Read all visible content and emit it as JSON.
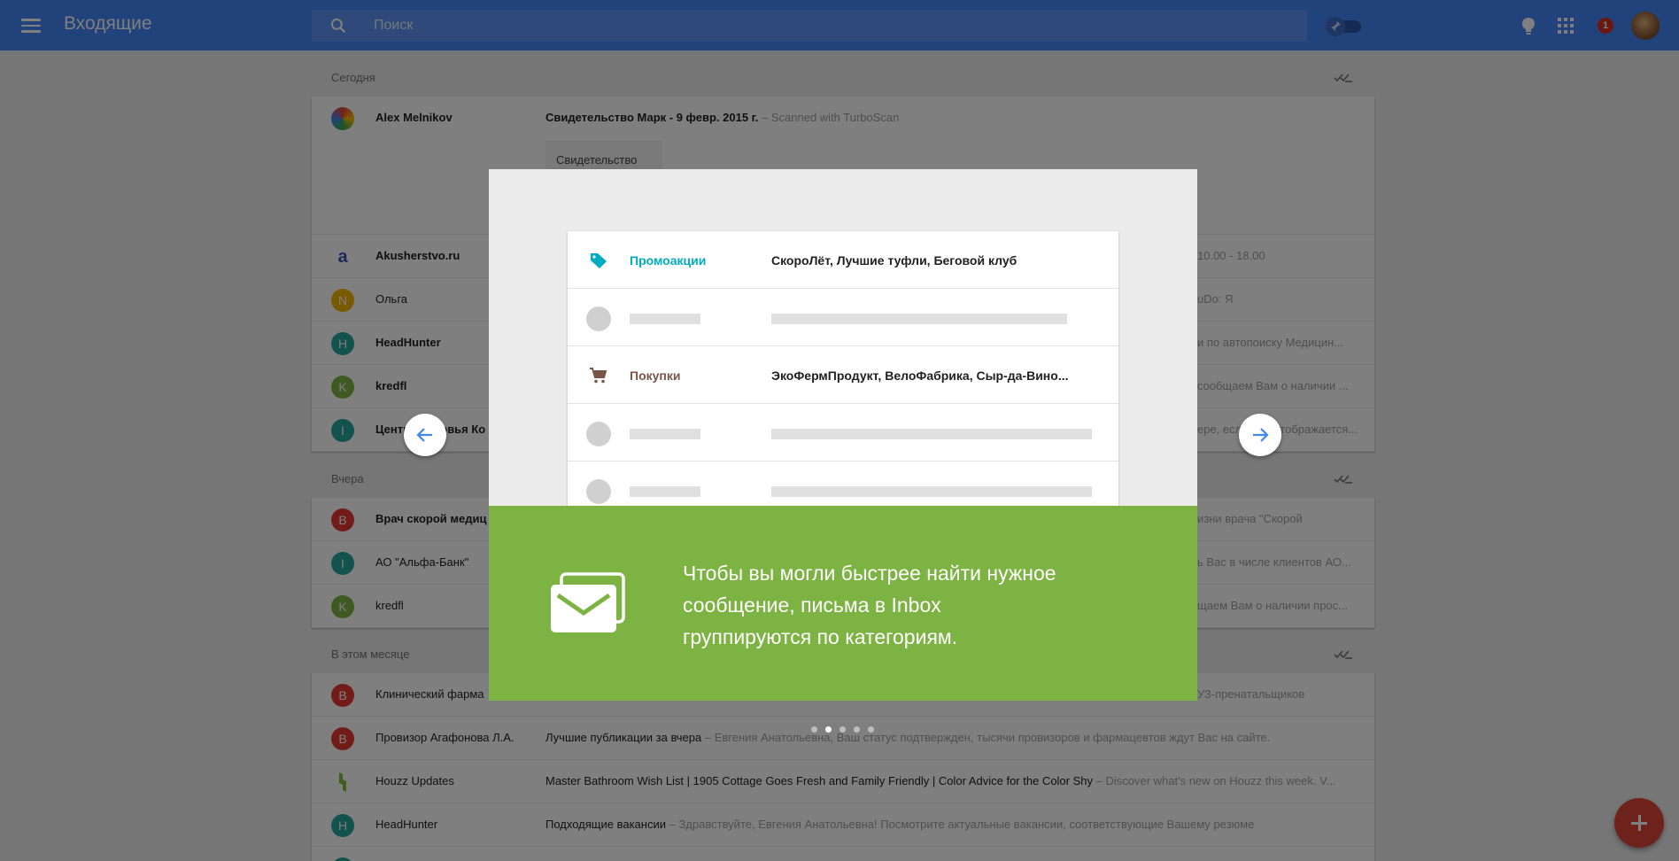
{
  "header": {
    "title": "Входящие",
    "search_placeholder": "Поиск",
    "notification_count": "1",
    "icons": [
      "menu-icon",
      "search-icon",
      "pin-toggle",
      "reminder-icon",
      "apps-icon",
      "avatar"
    ]
  },
  "inbox": {
    "sections": [
      {
        "label": "Сегодня",
        "rows": [
          {
            "sender": "Alex Melnikov",
            "subject": "Свидетельство Марк - 9 февр. 2015 г.",
            "snippet": " – Scanned with TurboScan",
            "attachment": "Свидетельство"
          },
          {
            "sender": "Akusherstvo.ru",
            "avatar": "a",
            "snippet": "10.00 - 18.00"
          },
          {
            "sender": "Ольга",
            "avatar": "N",
            "snippet": "uDo: Я"
          },
          {
            "sender": "HeadHunter",
            "avatar": "H",
            "snippet": "и по автопоиску Медицин..."
          },
          {
            "sender": "kredfl",
            "avatar": "K",
            "snippet": "сообщаем Вам о наличии ..."
          },
          {
            "sender": "Центр здоровья Ко",
            "avatar": "I",
            "snippet": "ере, если она отображается..."
          }
        ]
      },
      {
        "label": "Вчера",
        "rows": [
          {
            "sender": "Врач скорой медиц",
            "avatar": "B",
            "snippet": "изни врача \"Скорой"
          },
          {
            "sender": "АО \"Альфа-Банк\"",
            "avatar": "I",
            "snippet": "ь Вас в числе клиентов АО..."
          },
          {
            "sender": "kredfl",
            "avatar": "K",
            "snippet": "щаем Вам о наличии прос..."
          }
        ]
      },
      {
        "label": "В этом месяце",
        "rows": [
          {
            "sender": "Клинический фарма",
            "avatar": "B",
            "snippet": "УЗ-пренатальщиков"
          },
          {
            "sender": "Провизор Агафонова Л.А.",
            "avatar": "B",
            "subject": "Лучшие публикации за вчера",
            "snippet": " – Евгения Анатольевна, Ваш статус подтвержден, тысячи провизоров и фармацевтов ждут Вас на сайте."
          },
          {
            "sender": "Houzz Updates",
            "subject": "Master Bathroom Wish List | 1905 Cottage Goes Fresh and Family Friendly | Color Advice for the Color Shy",
            "snippet": " – Discover what's new on Houzz this week. V..."
          },
          {
            "sender": "HeadHunter",
            "avatar": "H",
            "subject": "Подходящие вакансии",
            "snippet": " – Здравствуйте, Евгения Анатольевна! Посмотрите актуальные вакансии, соответствующие Вашему резюме"
          }
        ]
      }
    ]
  },
  "tutorial": {
    "categories": [
      {
        "label": "Промоакции",
        "senders": "СкороЛёт, Лучшие туфли, Беговой клуб",
        "color": "#00acc1",
        "icon": "tag-icon"
      },
      {
        "label": "Покупки",
        "senders": "ЭкоФермПродукт, ВелоФабрика, Сыр-да-Вино...",
        "color": "#795548",
        "icon": "cart-icon"
      }
    ],
    "text": "Чтобы вы могли быстрее найти нужное сообщение, письма в Inbox группируются по категориям.",
    "accent": "#7cb342",
    "pager": {
      "count": 5,
      "active_index": 1
    }
  },
  "colors": {
    "brand_blue": "#4285f4",
    "fab_red": "#db4437",
    "badge_red": "#d93025"
  }
}
